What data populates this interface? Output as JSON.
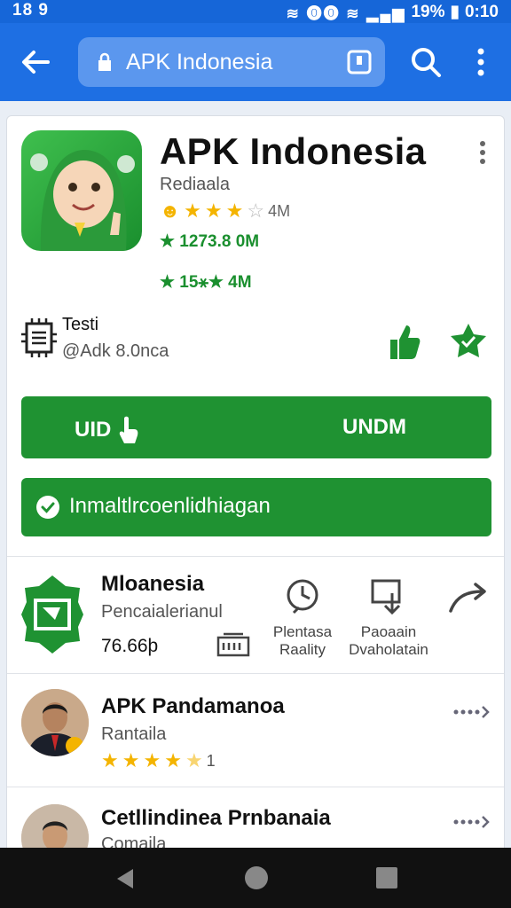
{
  "status_bar": {
    "time": "18 9",
    "icons": "≋ ⓿⓿ ≋ ▂▄▆",
    "battery": "19%",
    "clock": "0:10"
  },
  "browser": {
    "url": "APK Indonesia"
  },
  "app": {
    "title": "APK Indonesia",
    "developer": "Rediaala",
    "rating_text": "4M",
    "stat1": "★ 1273.8 0M",
    "stat2": "★ 15⚹★ 4M",
    "test_title": "Testi",
    "test_sub": "@Adk 8.0nca"
  },
  "buttons": {
    "main_left": "UID",
    "main_right": "UNDM",
    "install": "Inmaltlrcoenlidhiagan"
  },
  "featured": {
    "title": "Mloanesia",
    "subtitle": "Pencaialerianul",
    "price": "76.66þ",
    "action1": {
      "line1": "Plentasa",
      "line2": "Raality"
    },
    "action2": {
      "line1": "Paoaain",
      "line2": "Dvaholatain"
    }
  },
  "list": [
    {
      "title": "APK Pandamanoa",
      "subtitle": "Rantaila",
      "rating_count": "1"
    },
    {
      "title": "Cetllindinea Prnbanaia",
      "subtitle": "Comaila"
    }
  ],
  "colors": {
    "primary_blue": "#1e6fe3",
    "green": "#1f9232",
    "star": "#f4b400"
  }
}
